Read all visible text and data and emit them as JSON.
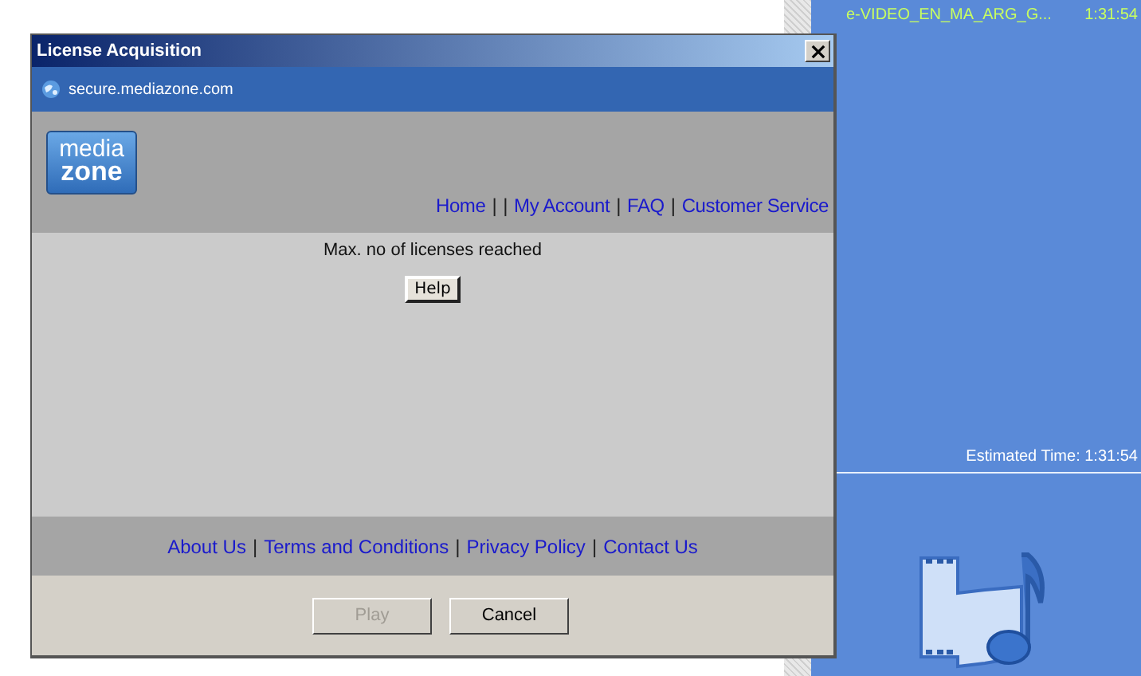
{
  "background_panel": {
    "file_name": "e-VIDEO_EN_MA_ARG_G...",
    "file_time": "1:31:54",
    "estimated_time": "Estimated Time: 1:31:54"
  },
  "window": {
    "title": "License Acquisition",
    "address": "secure.mediazone.com"
  },
  "header": {
    "logo_top": "media",
    "logo_bottom": "zone",
    "nav": [
      {
        "kind": "link",
        "label": "Home"
      },
      {
        "kind": "separator",
        "label": "|"
      },
      {
        "kind": "separator",
        "label": "|"
      },
      {
        "kind": "link",
        "label": "My Account"
      },
      {
        "kind": "separator",
        "label": "|"
      },
      {
        "kind": "link",
        "label": "FAQ"
      },
      {
        "kind": "separator",
        "label": "|"
      },
      {
        "kind": "link",
        "label": "Customer Service"
      }
    ]
  },
  "content": {
    "message": "Max. no of licenses reached",
    "help_button": "Help"
  },
  "footer": {
    "links": [
      {
        "kind": "link",
        "label": "About Us"
      },
      {
        "kind": "separator",
        "label": "|"
      },
      {
        "kind": "link",
        "label": "Terms and Conditions"
      },
      {
        "kind": "separator",
        "label": "|"
      },
      {
        "kind": "link",
        "label": "Privacy Policy"
      },
      {
        "kind": "separator",
        "label": "|"
      },
      {
        "kind": "link",
        "label": "Contact Us"
      }
    ]
  },
  "buttons": [
    {
      "label": "Play",
      "disabled": true
    },
    {
      "label": "Cancel",
      "disabled": false
    }
  ]
}
